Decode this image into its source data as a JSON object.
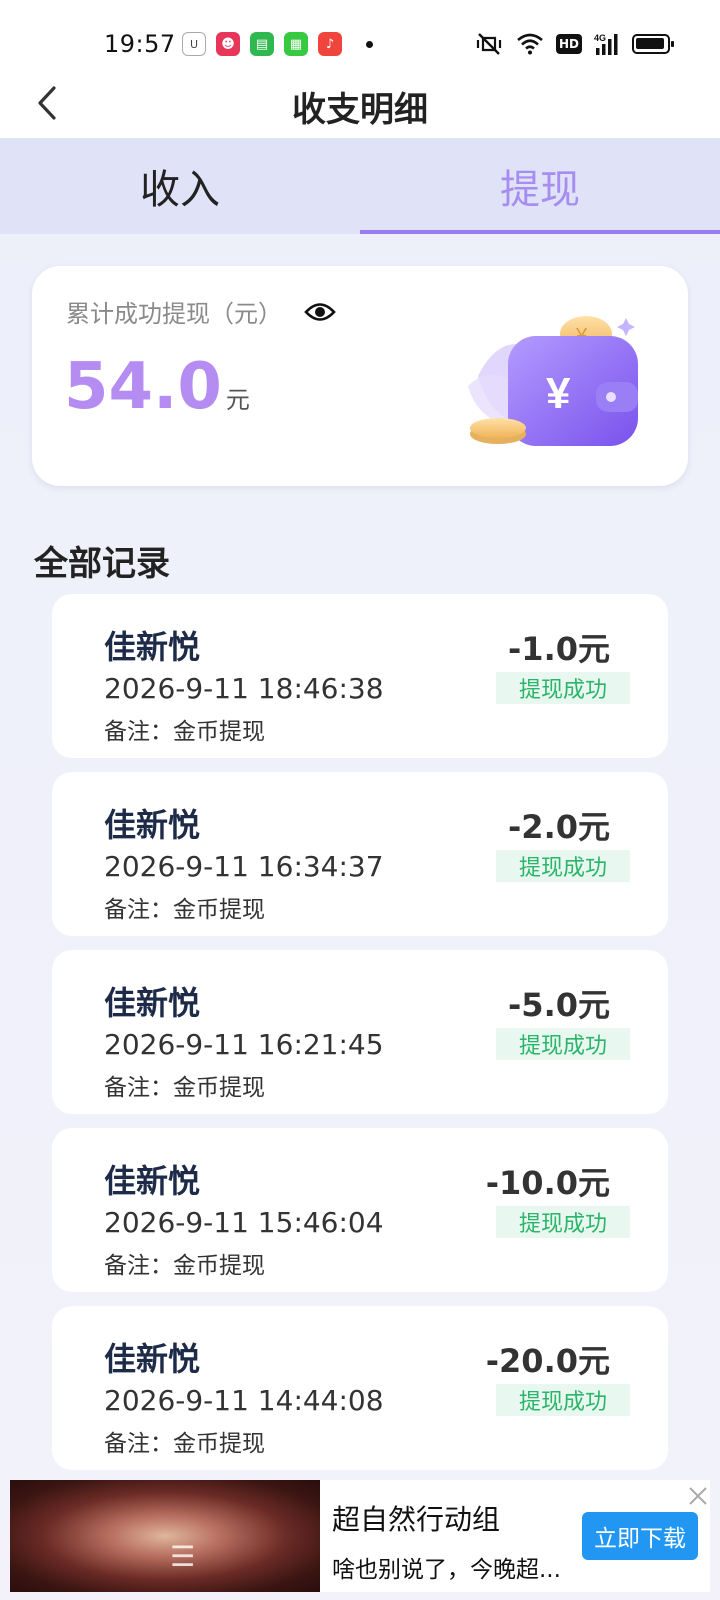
{
  "status_bar": {
    "time": "19:57"
  },
  "header": {
    "title": "收支明细"
  },
  "tabs": [
    {
      "label": "收入",
      "active": false
    },
    {
      "label": "提现",
      "active": true
    }
  ],
  "summary": {
    "label": "累计成功提现（元）",
    "value": "54.0",
    "unit": "元"
  },
  "section_title": "全部记录",
  "records": [
    {
      "name": "佳新悦",
      "time": "2026-9-11 18:46:38",
      "note": "备注：金币提现",
      "amount": "-1.0元",
      "status": "提现成功"
    },
    {
      "name": "佳新悦",
      "time": "2026-9-11 16:34:37",
      "note": "备注：金币提现",
      "amount": "-2.0元",
      "status": "提现成功"
    },
    {
      "name": "佳新悦",
      "time": "2026-9-11 16:21:45",
      "note": "备注：金币提现",
      "amount": "-5.0元",
      "status": "提现成功"
    },
    {
      "name": "佳新悦",
      "time": "2026-9-11 15:46:04",
      "note": "备注：金币提现",
      "amount": "-10.0元",
      "status": "提现成功"
    },
    {
      "name": "佳新悦",
      "time": "2026-9-11 14:44:08",
      "note": "备注：金币提现",
      "amount": "-20.0元",
      "status": "提现成功"
    }
  ],
  "ad": {
    "title": "超自然行动组",
    "description": "啥也别说了，今晚超...",
    "button_label": "立即下载"
  },
  "colors": {
    "accent_purple": "#a78df0",
    "success_green": "#2bb56a",
    "ad_button_blue": "#2196f3"
  }
}
